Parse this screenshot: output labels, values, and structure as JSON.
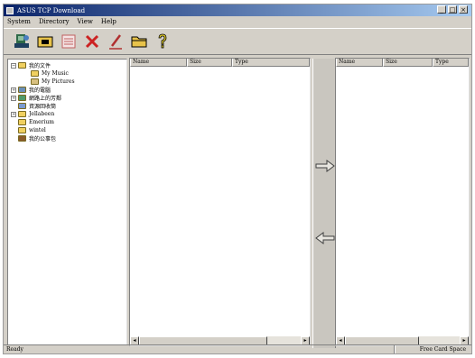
{
  "window": {
    "title": "ASUS TCP Download",
    "controls": [
      "_",
      "□",
      "×"
    ]
  },
  "menu": [
    "System",
    "Directory",
    "View",
    "Help"
  ],
  "toolbar": [
    {
      "name": "connect-icon",
      "color": "#2e6a48"
    },
    {
      "name": "download-icon",
      "color": "#e8c34a"
    },
    {
      "name": "list-icon",
      "color": "#c06060"
    },
    {
      "name": "delete-icon",
      "color": "#cc2222"
    },
    {
      "name": "edit-icon",
      "color": "#b03030"
    },
    {
      "name": "folder-icon",
      "color": "#e8c34a"
    },
    {
      "name": "help-icon",
      "color": "#e8d22a"
    }
  ],
  "tree": [
    {
      "label": "我的文件",
      "level": 0,
      "expander": "−",
      "icon": "folder-open"
    },
    {
      "label": "My Music",
      "level": 1,
      "expander": "",
      "icon": "folder"
    },
    {
      "label": "My Pictures",
      "level": 1,
      "expander": "",
      "icon": "folder-pictures"
    },
    {
      "label": "我的電腦",
      "level": 0,
      "expander": "+",
      "icon": "computer"
    },
    {
      "label": "網路上的芳鄰",
      "level": 0,
      "expander": "+",
      "icon": "network"
    },
    {
      "label": "資源回收筒",
      "level": 0,
      "expander": "",
      "icon": "recycle"
    },
    {
      "label": "Jellabeen",
      "level": 0,
      "expander": "+",
      "icon": "folder"
    },
    {
      "label": "Emerium",
      "level": 0,
      "expander": "",
      "icon": "folder"
    },
    {
      "label": "wintel",
      "level": 0,
      "expander": "",
      "icon": "folder"
    },
    {
      "label": "我的公事包",
      "level": 0,
      "expander": "",
      "icon": "briefcase"
    }
  ],
  "left_pane": {
    "columns": [
      "Name",
      "Size",
      "Type"
    ]
  },
  "right_pane": {
    "columns": [
      "Name",
      "Size",
      "Type"
    ]
  },
  "transfer": {
    "to_right": "right-arrow-icon",
    "to_left": "left-arrow-icon"
  },
  "status": {
    "text": "Ready",
    "free_space": "Free Card Space"
  }
}
